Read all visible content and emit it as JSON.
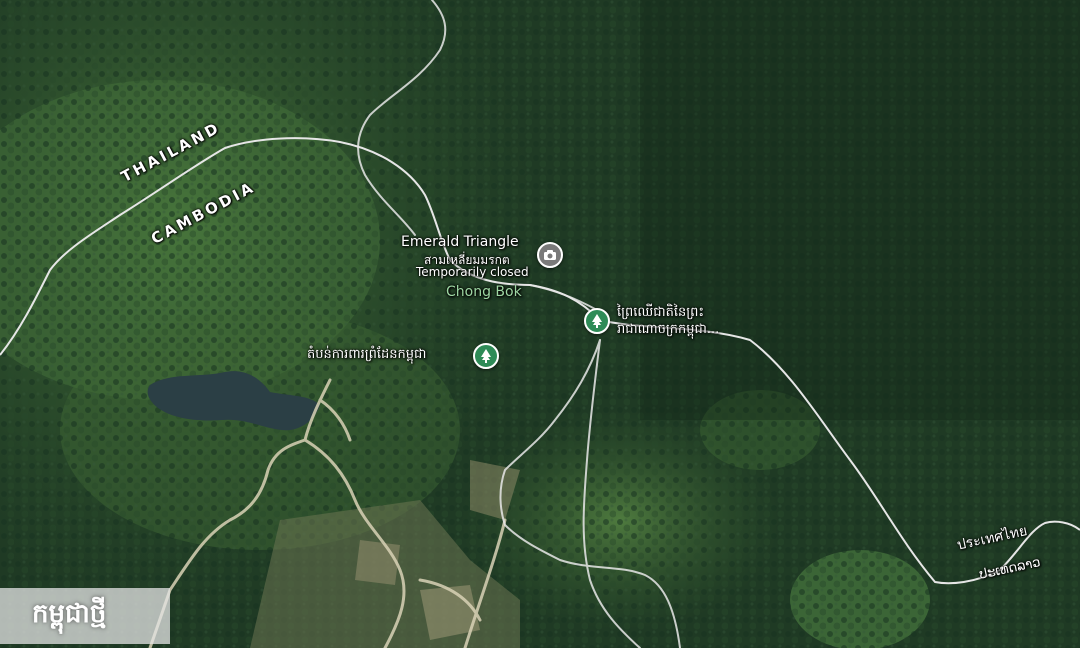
{
  "map": {
    "country_labels": {
      "thailand": "THAILAND",
      "cambodia": "CAMBODIA",
      "thailand_thai": "ประเทศไทย",
      "laos_thai": "ປະເທດລາວ"
    },
    "places": {
      "emerald_triangle": {
        "title": "Emerald Triangle",
        "subtitle_thai": "สามเหลี่ยมมรกต",
        "status": "Temporarily closed",
        "icon": "camera-icon"
      },
      "chong_bok": "Chong Bok",
      "preah_vihear_forest": {
        "line1": "ព្រៃឈើជាតិនៃព្រះ",
        "line2": "រាជាណាចក្រកម្ពុជា...",
        "icon": "tree-icon"
      },
      "border_protection_area": {
        "label": "តំបន់ការពារព្រំដែនកម្ពុជា",
        "icon": "tree-icon"
      }
    },
    "watermark": "កម្ពុជាថ្មី",
    "colors": {
      "forest_dark": "#1d3a22",
      "forest_light": "#3f6a35",
      "water": "#2b3f45",
      "road": "#d8d8d8",
      "border": "#e6e6e6",
      "pin_green": "#2e8b57",
      "pin_grey": "#7a7a7a"
    }
  }
}
